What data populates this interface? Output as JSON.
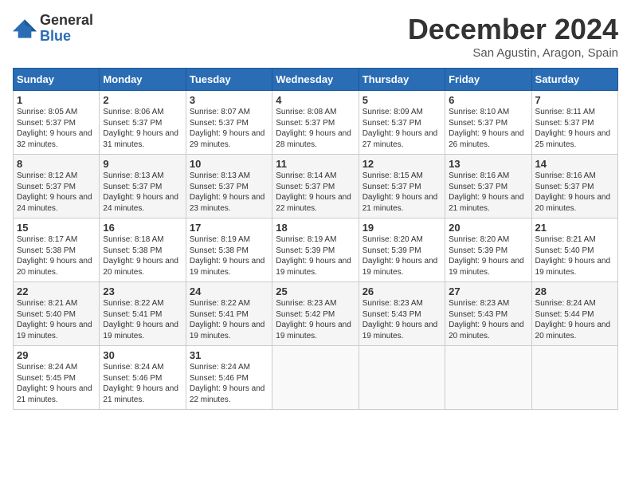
{
  "logo": {
    "general": "General",
    "blue": "Blue"
  },
  "title": "December 2024",
  "location": "San Agustin, Aragon, Spain",
  "days_of_week": [
    "Sunday",
    "Monday",
    "Tuesday",
    "Wednesday",
    "Thursday",
    "Friday",
    "Saturday"
  ],
  "weeks": [
    [
      {
        "day": "1",
        "sunrise": "8:05 AM",
        "sunset": "5:37 PM",
        "daylight": "9 hours and 32 minutes."
      },
      {
        "day": "2",
        "sunrise": "8:06 AM",
        "sunset": "5:37 PM",
        "daylight": "9 hours and 31 minutes."
      },
      {
        "day": "3",
        "sunrise": "8:07 AM",
        "sunset": "5:37 PM",
        "daylight": "9 hours and 29 minutes."
      },
      {
        "day": "4",
        "sunrise": "8:08 AM",
        "sunset": "5:37 PM",
        "daylight": "9 hours and 28 minutes."
      },
      {
        "day": "5",
        "sunrise": "8:09 AM",
        "sunset": "5:37 PM",
        "daylight": "9 hours and 27 minutes."
      },
      {
        "day": "6",
        "sunrise": "8:10 AM",
        "sunset": "5:37 PM",
        "daylight": "9 hours and 26 minutes."
      },
      {
        "day": "7",
        "sunrise": "8:11 AM",
        "sunset": "5:37 PM",
        "daylight": "9 hours and 25 minutes."
      }
    ],
    [
      {
        "day": "8",
        "sunrise": "8:12 AM",
        "sunset": "5:37 PM",
        "daylight": "9 hours and 24 minutes."
      },
      {
        "day": "9",
        "sunrise": "8:13 AM",
        "sunset": "5:37 PM",
        "daylight": "9 hours and 24 minutes."
      },
      {
        "day": "10",
        "sunrise": "8:13 AM",
        "sunset": "5:37 PM",
        "daylight": "9 hours and 23 minutes."
      },
      {
        "day": "11",
        "sunrise": "8:14 AM",
        "sunset": "5:37 PM",
        "daylight": "9 hours and 22 minutes."
      },
      {
        "day": "12",
        "sunrise": "8:15 AM",
        "sunset": "5:37 PM",
        "daylight": "9 hours and 21 minutes."
      },
      {
        "day": "13",
        "sunrise": "8:16 AM",
        "sunset": "5:37 PM",
        "daylight": "9 hours and 21 minutes."
      },
      {
        "day": "14",
        "sunrise": "8:16 AM",
        "sunset": "5:37 PM",
        "daylight": "9 hours and 20 minutes."
      }
    ],
    [
      {
        "day": "15",
        "sunrise": "8:17 AM",
        "sunset": "5:38 PM",
        "daylight": "9 hours and 20 minutes."
      },
      {
        "day": "16",
        "sunrise": "8:18 AM",
        "sunset": "5:38 PM",
        "daylight": "9 hours and 20 minutes."
      },
      {
        "day": "17",
        "sunrise": "8:19 AM",
        "sunset": "5:38 PM",
        "daylight": "9 hours and 19 minutes."
      },
      {
        "day": "18",
        "sunrise": "8:19 AM",
        "sunset": "5:39 PM",
        "daylight": "9 hours and 19 minutes."
      },
      {
        "day": "19",
        "sunrise": "8:20 AM",
        "sunset": "5:39 PM",
        "daylight": "9 hours and 19 minutes."
      },
      {
        "day": "20",
        "sunrise": "8:20 AM",
        "sunset": "5:39 PM",
        "daylight": "9 hours and 19 minutes."
      },
      {
        "day": "21",
        "sunrise": "8:21 AM",
        "sunset": "5:40 PM",
        "daylight": "9 hours and 19 minutes."
      }
    ],
    [
      {
        "day": "22",
        "sunrise": "8:21 AM",
        "sunset": "5:40 PM",
        "daylight": "9 hours and 19 minutes."
      },
      {
        "day": "23",
        "sunrise": "8:22 AM",
        "sunset": "5:41 PM",
        "daylight": "9 hours and 19 minutes."
      },
      {
        "day": "24",
        "sunrise": "8:22 AM",
        "sunset": "5:41 PM",
        "daylight": "9 hours and 19 minutes."
      },
      {
        "day": "25",
        "sunrise": "8:23 AM",
        "sunset": "5:42 PM",
        "daylight": "9 hours and 19 minutes."
      },
      {
        "day": "26",
        "sunrise": "8:23 AM",
        "sunset": "5:43 PM",
        "daylight": "9 hours and 19 minutes."
      },
      {
        "day": "27",
        "sunrise": "8:23 AM",
        "sunset": "5:43 PM",
        "daylight": "9 hours and 20 minutes."
      },
      {
        "day": "28",
        "sunrise": "8:24 AM",
        "sunset": "5:44 PM",
        "daylight": "9 hours and 20 minutes."
      }
    ],
    [
      {
        "day": "29",
        "sunrise": "8:24 AM",
        "sunset": "5:45 PM",
        "daylight": "9 hours and 21 minutes."
      },
      {
        "day": "30",
        "sunrise": "8:24 AM",
        "sunset": "5:46 PM",
        "daylight": "9 hours and 21 minutes."
      },
      {
        "day": "31",
        "sunrise": "8:24 AM",
        "sunset": "5:46 PM",
        "daylight": "9 hours and 22 minutes."
      },
      null,
      null,
      null,
      null
    ]
  ]
}
